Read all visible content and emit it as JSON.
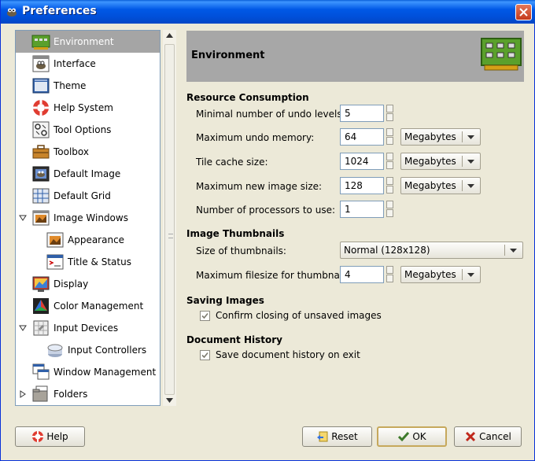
{
  "window": {
    "title": "Preferences"
  },
  "sidebar": {
    "items": [
      {
        "label": "Environment",
        "icon": "environment-icon",
        "selected": true
      },
      {
        "label": "Interface",
        "icon": "interface-icon"
      },
      {
        "label": "Theme",
        "icon": "theme-icon"
      },
      {
        "label": "Help System",
        "icon": "help-system-icon"
      },
      {
        "label": "Tool Options",
        "icon": "tool-options-icon"
      },
      {
        "label": "Toolbox",
        "icon": "toolbox-icon"
      },
      {
        "label": "Default Image",
        "icon": "default-image-icon"
      },
      {
        "label": "Default Grid",
        "icon": "default-grid-icon"
      },
      {
        "label": "Image Windows",
        "icon": "image-windows-icon",
        "expanded": true
      },
      {
        "label": "Appearance",
        "icon": "appearance-icon"
      },
      {
        "label": "Title & Status",
        "icon": "title-status-icon"
      },
      {
        "label": "Display",
        "icon": "display-icon"
      },
      {
        "label": "Color Management",
        "icon": "color-management-icon"
      },
      {
        "label": "Input Devices",
        "icon": "input-devices-icon",
        "expanded": true
      },
      {
        "label": "Input Controllers",
        "icon": "input-controllers-icon"
      },
      {
        "label": "Window Management",
        "icon": "window-management-icon"
      },
      {
        "label": "Folders",
        "icon": "folders-icon",
        "expanded": false
      }
    ]
  },
  "page": {
    "title": "Environment"
  },
  "resource": {
    "title": "Resource Consumption",
    "undo_levels": {
      "label": "Minimal number of undo levels:",
      "value": "5"
    },
    "undo_memory": {
      "label": "Maximum undo memory:",
      "value": "64",
      "unit": "Megabytes"
    },
    "tile_cache": {
      "label": "Tile cache size:",
      "value": "1024",
      "unit": "Megabytes"
    },
    "max_image": {
      "label": "Maximum new image size:",
      "value": "128",
      "unit": "Megabytes"
    },
    "processors": {
      "label": "Number of processors to use:",
      "value": "1"
    }
  },
  "thumbnails": {
    "title": "Image Thumbnails",
    "size": {
      "label": "Size of thumbnails:",
      "value": "Normal (128x128)"
    },
    "filesize": {
      "label": "Maximum filesize for thumbnailing:",
      "value": "4",
      "unit": "Megabytes"
    }
  },
  "saving": {
    "title": "Saving Images",
    "confirm": {
      "label": "Confirm closing of unsaved images",
      "checked": true
    }
  },
  "history": {
    "title": "Document History",
    "save": {
      "label": "Save document history on exit",
      "checked": true
    }
  },
  "buttons": {
    "help": "Help",
    "reset": "Reset",
    "ok": "OK",
    "cancel": "Cancel"
  },
  "colors": {
    "titlebar": "#0058e6",
    "selection": "#a5a5a5",
    "dialog_bg": "#ece9d8"
  }
}
